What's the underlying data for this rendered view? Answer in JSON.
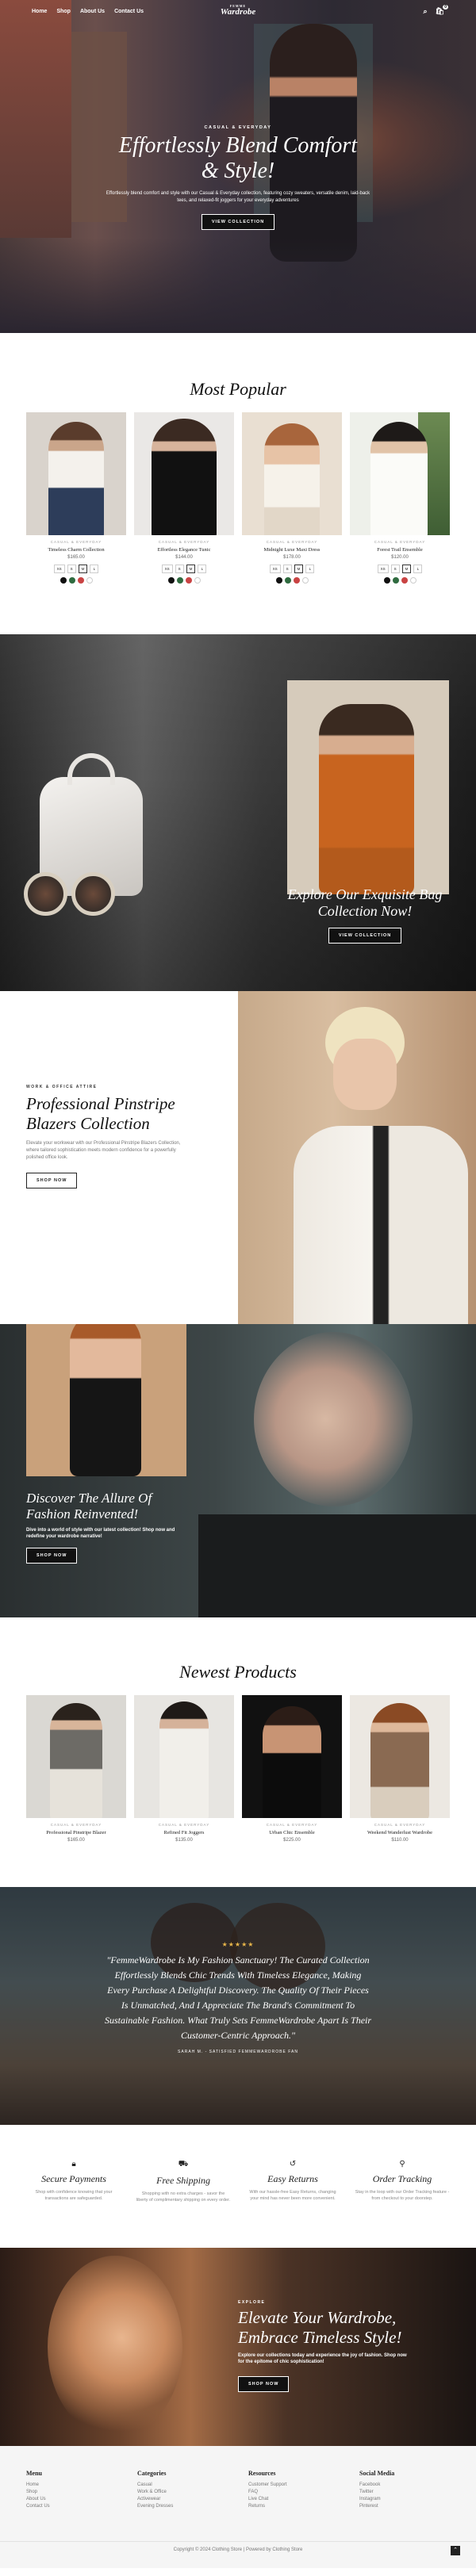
{
  "nav": {
    "links": [
      "Home",
      "Shop",
      "About Us",
      "Contact Us"
    ],
    "logo_top": "FEMME",
    "logo": "Wardrobe",
    "cart_count": "0"
  },
  "hero": {
    "eyebrow": "CASUAL & EVERYDAY",
    "title_line1": "Effortlessly Blend Comfort",
    "title_line2": "& Style!",
    "text": "Effortlessly blend comfort and style with our Casual & Everyday collection, featuring cozy sweaters, versatile denim, laid-back tees, and relaxed-fit joggers for your everyday adventures",
    "button": "VIEW COLLECTION"
  },
  "most_popular": {
    "title": "Most Popular",
    "products": [
      {
        "cat": "CASUAL & EVERYDAY",
        "name": "Timeless Charm Collection",
        "price": "$165.00",
        "sizes": [
          "XS",
          "S",
          "M",
          "L"
        ],
        "swatches": [
          "#111111",
          "#2f6b3f",
          "#c94343",
          "#ffffff"
        ]
      },
      {
        "cat": "CASUAL & EVERYDAY",
        "name": "Effortless Elegance Tunic",
        "price": "$144.00",
        "sizes": [
          "XS",
          "S",
          "M",
          "L"
        ],
        "swatches": [
          "#111111",
          "#2f6b3f",
          "#c94343",
          "#ffffff"
        ]
      },
      {
        "cat": "CASUAL & EVERYDAY",
        "name": "Midnight Luxe Maxi Dress",
        "price": "$178.00",
        "sizes": [
          "XS",
          "S",
          "M",
          "L"
        ],
        "swatches": [
          "#111111",
          "#2f6b3f",
          "#c94343",
          "#ffffff"
        ]
      },
      {
        "cat": "CASUAL & EVERYDAY",
        "name": "Forest Trail Ensemble",
        "price": "$120.00",
        "sizes": [
          "XS",
          "S",
          "M",
          "L"
        ],
        "swatches": [
          "#111111",
          "#2f6b3f",
          "#c94343",
          "#ffffff"
        ]
      }
    ]
  },
  "bags": {
    "title_line1": "Explore Our Exquisite Bag",
    "title_line2": "Collection Now!",
    "button": "VIEW COLLECTION"
  },
  "blazers": {
    "eyebrow": "WORK & OFFICE ATTIRE",
    "title_line1": "Professional Pinstripe",
    "title_line2": "Blazers Collection",
    "text": "Elevate your workwear with our Professional Pinstripe Blazers Collection, where tailored sophistication meets modern confidence for a powerfully polished office look.",
    "button": "SHOP NOW"
  },
  "allure": {
    "title_line1": "Discover The Allure Of",
    "title_line2": "Fashion Reinvented!",
    "text": "Dive into a world of style with our latest collection! Shop now and redefine your wardrobe narrative!",
    "button": "SHOP NOW"
  },
  "newest": {
    "title": "Newest Products",
    "products": [
      {
        "cat": "CASUAL & EVERYDAY",
        "name": "Professional Pinstripe Blazer",
        "price": "$165.00"
      },
      {
        "cat": "CASUAL & EVERYDAY",
        "name": "Refined Fit Joggers",
        "price": "$135.00"
      },
      {
        "cat": "CASUAL & EVERYDAY",
        "name": "Urban Chic Ensemble",
        "price": "$225.00"
      },
      {
        "cat": "CASUAL & EVERYDAY",
        "name": "Weekend Wanderlust Wardrobe",
        "price": "$110.00"
      }
    ]
  },
  "testimonial": {
    "stars": "★★★★★",
    "quote": "\"FemmeWardrobe Is My Fashion Sanctuary! The Curated Collection Effortlessly Blends Chic Trends With Timeless Elegance, Making Every Purchase A Delightful Discovery. The Quality Of Their Pieces Is Unmatched, And I Appreciate The Brand's Commitment To Sustainable Fashion. What Truly Sets FemmeWardrobe Apart Is Their Customer-Centric Approach.\"",
    "author": "SARAH M. - SATISFIED FEMMEWARDROBE FAN"
  },
  "features": [
    {
      "icon": "lock-icon",
      "title": "Secure Payments",
      "text": "Shop with confidence knowing that your transactions are safeguarded."
    },
    {
      "icon": "truck-icon",
      "title": "Free Shipping",
      "text": "Shopping with no extra charges - savor the liberty of complimentary shipping on every order."
    },
    {
      "icon": "return-icon",
      "title": "Easy Returns",
      "text": "With our hassle-free Easy Returns, changing your mind has never been more convenient."
    },
    {
      "icon": "pin-icon",
      "title": "Order Tracking",
      "text": "Stay in the loop with our Order Tracking feature - from checkout to your doorstep."
    }
  ],
  "timeless": {
    "eyebrow": "EXPLORE",
    "title_line1": "Elevate Your Wardrobe,",
    "title_line2": "Embrace Timeless Style!",
    "text": "Explore our collections today and experience the joy of fashion. Shop now for the epitome of chic sophistication!",
    "button": "SHOP NOW"
  },
  "footer": {
    "cols": [
      {
        "h": "Menu",
        "items": [
          "Home",
          "Shop",
          "About Us",
          "Contact Us"
        ]
      },
      {
        "h": "Categories",
        "items": [
          "Casual",
          "Work & Office",
          "Activewear",
          "Evening Dresses"
        ]
      },
      {
        "h": "Resources",
        "items": [
          "Customer Support",
          "FAQ",
          "Live Chat",
          "Returns"
        ]
      },
      {
        "h": "Social Media",
        "items": [
          "Facebook",
          "Twitter",
          "Instagram",
          "Pinterest"
        ]
      }
    ],
    "copyright": "Copyright © 2024 Clothing Store | Powered by Clothing Store"
  }
}
